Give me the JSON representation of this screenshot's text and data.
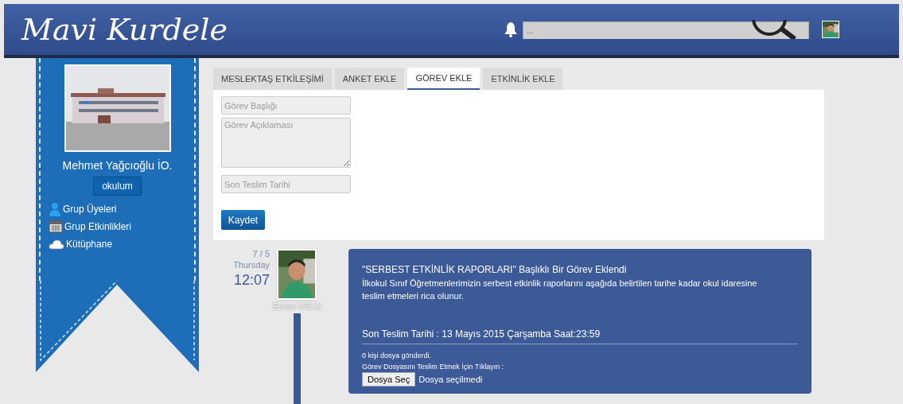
{
  "header": {
    "logo": "Mavi Kurdele",
    "search": {
      "placeholder": "..."
    }
  },
  "sidebar": {
    "school_name": "Mehmet Yağcıoğlu İO.",
    "button": "okulum",
    "links": [
      {
        "kind": "person",
        "label": "Grup Üyeleri"
      },
      {
        "kind": "calendar",
        "label": "Grup Etkinlikleri"
      },
      {
        "kind": "cloud",
        "label": "Kütüphane"
      }
    ]
  },
  "tabs": [
    {
      "label": "MESLEKTAŞ ETKİLEŞİMİ",
      "selected": false
    },
    {
      "label": "ANKET EKLE",
      "selected": false
    },
    {
      "label": "GÖREV EKLE",
      "selected": true
    },
    {
      "label": "ETKİNLİK EKLE",
      "selected": false
    }
  ],
  "form": {
    "title_placeholder": "Görev Başlığı",
    "description_placeholder": "Görev Açıklaması",
    "deadline_placeholder": "Son Teslim Tarihi",
    "submit": "Kaydet"
  },
  "post": {
    "date": "7 / 5",
    "weekday": "Thursday",
    "time": "12:07",
    "author": "Ercan USLU",
    "title": "\"SERBEST ETKİNLİK RAPORLARI\" Başlıklı Bir Görev Eklendi",
    "body": "İlkokul Sınıf Öğretmenlerimizin serbest etkinlik raporlarını aşağıda belirtilen tarihe kadar okul idaresine teslim etmeleri rica olunur.",
    "deadline": "Son Teslim Tarihi : 13 Mayıs 2015 Çarşamba Saat:23:59",
    "sent_count": "0 kişi dosya gönderdi.",
    "upload_prompt": "Görev Dosyasını Teslim Etmek İçin Tıklayın :",
    "file_button": "Dosya Seç",
    "file_status": "Dosya seçilmedi"
  }
}
